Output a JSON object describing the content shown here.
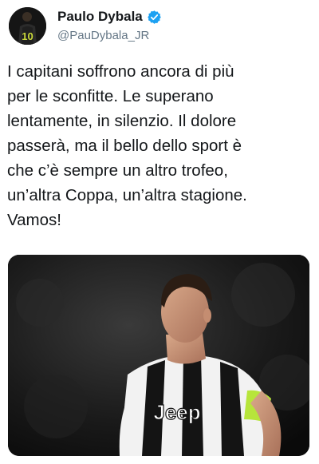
{
  "tweet": {
    "author": {
      "display_name": "Paulo Dybala",
      "handle": "@PauDybala_JR",
      "verified": true,
      "avatar_icon": "player-avatar-icon",
      "avatar_number": "10"
    },
    "text": "I capitani soffrono ancora di più\nper le sconfitte. Le superano\nlentamente, in silenzio. Il dolore\npasserà, ma il bello dello sport è\nche c’è sempre un altro trofeo,\nun’altra Coppa, un’altra stagione.\nVamos!",
    "media": {
      "icon": "photo-football-player",
      "shirt_text": "Jeep"
    }
  },
  "colors": {
    "verified_blue": "#1da1f2",
    "text": "#14171a",
    "handle_gray": "#657786",
    "captain_band": "#b7e53b"
  }
}
